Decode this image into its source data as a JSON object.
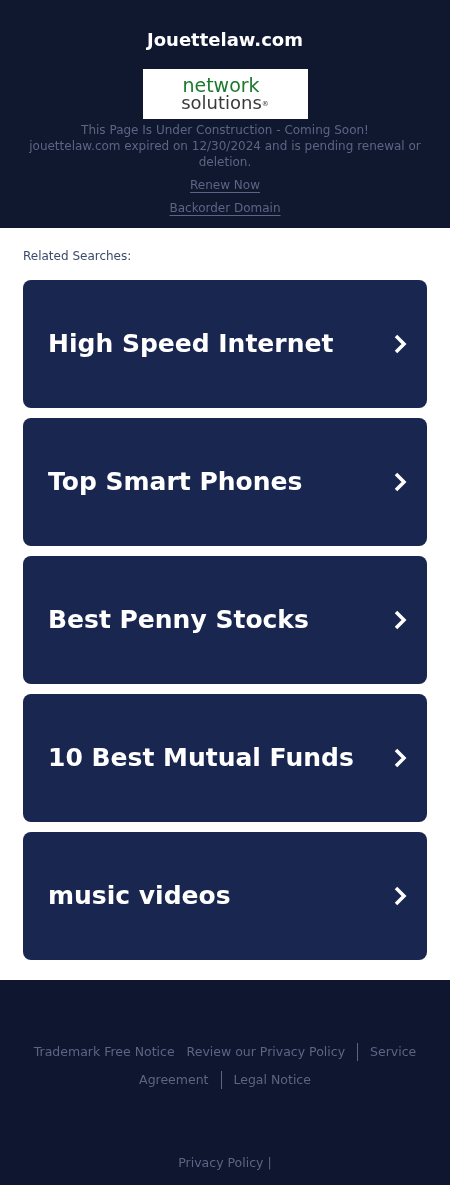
{
  "header": {
    "title": "Jouettelaw.com",
    "logo": {
      "line_1": "network",
      "line_2": "solutions",
      "mark": "®"
    },
    "notice": "This Page Is Under Construction - Coming Soon!",
    "expiry": "jouettelaw.com expired on 12/30/2024 and is pending renewal or deletion.",
    "links": [
      "Renew Now",
      "Backorder Domain"
    ]
  },
  "related": {
    "heading": "Related Searches:",
    "items": [
      {
        "label": "High Speed Internet"
      },
      {
        "label": "Top Smart Phones"
      },
      {
        "label": "Best Penny Stocks"
      },
      {
        "label": "10 Best Mutual Funds"
      },
      {
        "label": "music videos"
      }
    ]
  },
  "footer": {
    "lines": [
      [
        {
          "label": "Trademark Free Notice",
          "divider_before": false
        },
        {
          "label": "Review our Privacy Policy",
          "divider_before": false
        },
        {
          "label": "Service",
          "divider_before": true
        }
      ],
      [
        {
          "label": "Agreement",
          "divider_before": false
        },
        {
          "label": "Legal Notice",
          "divider_before": true
        }
      ]
    ],
    "bottom_link": "Privacy Policy",
    "bottom_separator": "|"
  }
}
